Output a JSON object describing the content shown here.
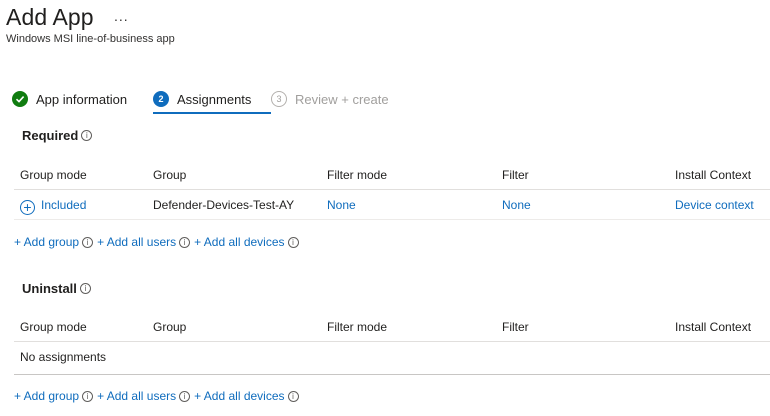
{
  "header": {
    "title": "Add App",
    "more": "...",
    "subtitle": "Windows MSI line-of-business app"
  },
  "steps": [
    {
      "label": "App information",
      "number": "",
      "state": "done"
    },
    {
      "label": "Assignments",
      "number": "2",
      "state": "current"
    },
    {
      "label": "Review + create",
      "number": "3",
      "state": "future"
    }
  ],
  "required": {
    "title": "Required",
    "columns": [
      "Group mode",
      "Group",
      "Filter mode",
      "Filter",
      "Install Context"
    ],
    "rows": [
      {
        "group_mode": "Included",
        "group": "Defender-Devices-Test-AY",
        "filter_mode": "None",
        "filter": "None",
        "install_context": "Device context"
      }
    ],
    "add_links": [
      "+ Add group",
      "+ Add all users",
      "+ Add all devices"
    ]
  },
  "uninstall": {
    "title": "Uninstall",
    "columns": [
      "Group mode",
      "Group",
      "Filter mode",
      "Filter",
      "Install Context"
    ],
    "empty_text": "No assignments",
    "add_links": [
      "+ Add group",
      "+ Add all users",
      "+ Add all devices"
    ]
  },
  "colors": {
    "accent": "#0f6cbd",
    "success": "#107c10"
  },
  "icons": {
    "info": "info-icon",
    "check": "check-circle-icon",
    "plus": "plus-circle-icon"
  }
}
